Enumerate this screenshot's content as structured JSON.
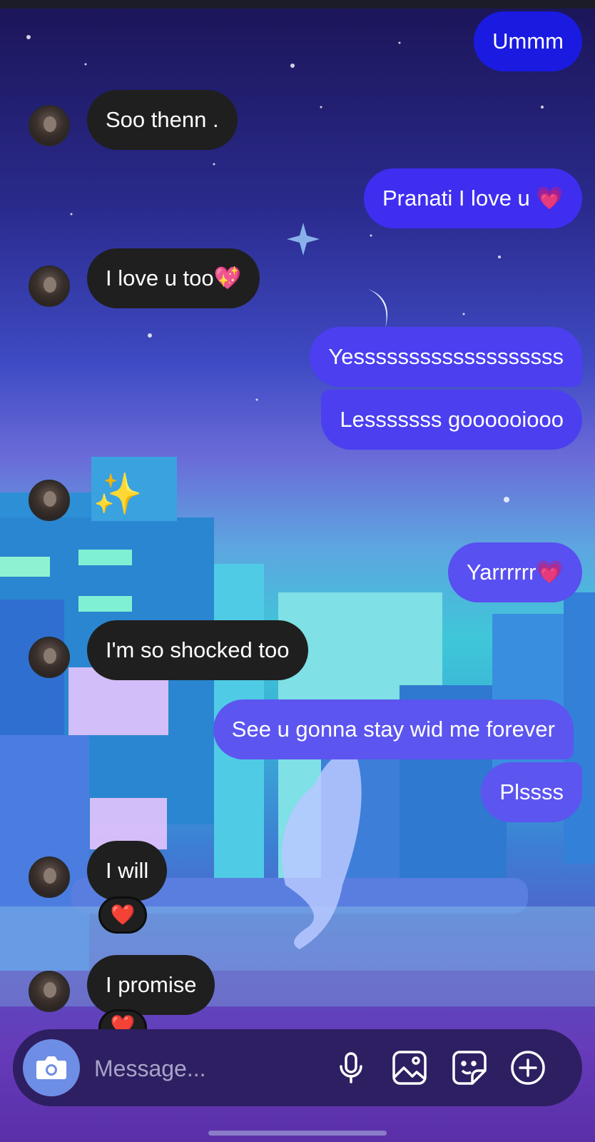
{
  "conversation": {
    "messages": [
      {
        "sender": "me",
        "text": "Ummm"
      },
      {
        "sender": "them",
        "text": "Soo thenn ."
      },
      {
        "sender": "me",
        "text": "Pranati I love u 💗"
      },
      {
        "sender": "them",
        "text": "I love u too💖"
      },
      {
        "sender": "me",
        "text": "Yesssssssssssssssssss"
      },
      {
        "sender": "me",
        "text": "Lesssssss goooooiooo"
      },
      {
        "sender": "them",
        "text": "✨"
      },
      {
        "sender": "me",
        "text": "Yarrrrrr💗"
      },
      {
        "sender": "them",
        "text": "I'm so shocked too"
      },
      {
        "sender": "me",
        "text": "See u gonna stay wid me forever"
      },
      {
        "sender": "me",
        "text": "Plssss"
      },
      {
        "sender": "them",
        "text": "I will",
        "reaction": "❤️"
      },
      {
        "sender": "them",
        "text": "I promise",
        "reaction": "❤️"
      }
    ]
  },
  "composer": {
    "placeholder": "Message...",
    "icons": [
      "camera-icon",
      "microphone-icon",
      "image-icon",
      "sticker-icon",
      "plus-circle-icon"
    ]
  },
  "colors": {
    "incoming_bubble": "#1f1f1f",
    "outgoing_top": "#1a1ae0",
    "outgoing_bottom": "#6a5ef0",
    "composer_bg": "#2e1f62",
    "camera_button": "#6e8ee6"
  }
}
